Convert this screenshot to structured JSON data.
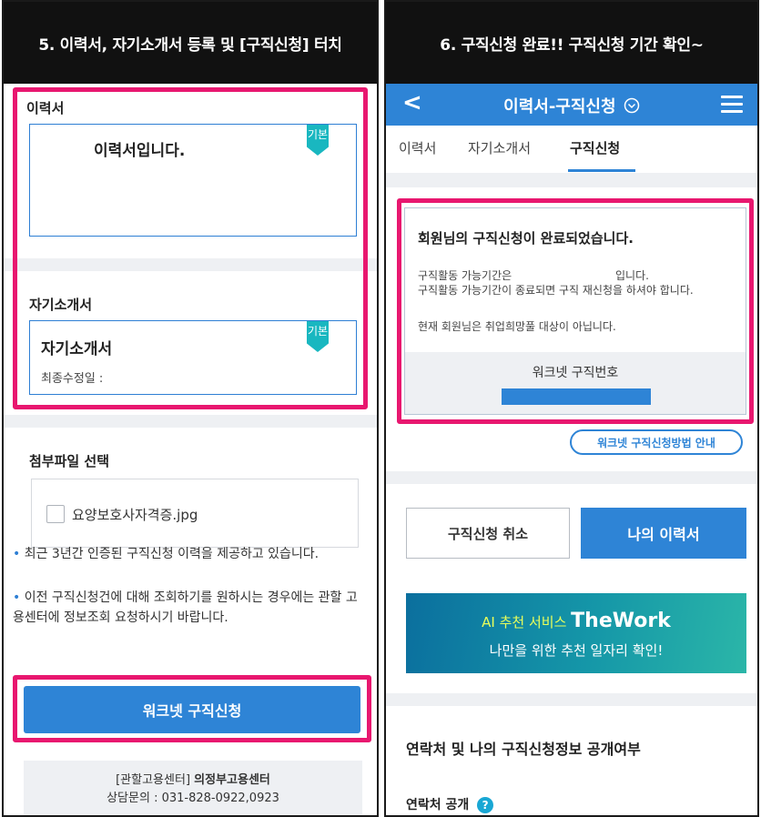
{
  "left": {
    "header": "5. 이력서, 자기소개서 등록 및 [구직신청] 터치",
    "resume_label": "이력서",
    "resume_card_text": "이력서입니다.",
    "badge_label": "기본",
    "intro_label": "자기소개서",
    "intro_card_title": "자기소개서",
    "intro_card_modified": "최종수정일 :",
    "attach_label": "첨부파일 선택",
    "attach_file": "요양보호사자격증.jpg",
    "notes": [
      "최근 3년간 인증된 구직신청 이력을 제공하고 있습니다.",
      "이전 구직신청건에 대해 조회하기를 원하시는 경우에는 관할 고용센터에 정보조회 요청하시기 바랍니다."
    ],
    "apply_button": "워크넷 구직신청",
    "center_prefix": "[관할고용센터]",
    "center_name": "의정부고용센터",
    "consult": "상담문의 : 031-828-0922,0923"
  },
  "right": {
    "header": "6. 구직신청 완료!! 구직신청 기간 확인~",
    "appbar_back": "<",
    "appbar_title": "이력서-구직신청",
    "tabs": [
      "이력서",
      "자기소개서",
      "구직신청"
    ],
    "done_title": "회원님의 구직신청이 완료되었습니다.",
    "done_line1a": "구직활동 가능기간은",
    "done_line1b": "입니다.",
    "done_line2": "구직활동 가능기간이 종료되면 구직 재신청을 하셔야 합니다.",
    "done_line3": "현재 회원님은 취업희망풀 대상이 아닙니다.",
    "worknet_label": "워크넷 구직번호",
    "guide_button": "워크넷 구직신청방법 안내",
    "cancel_button": "구직신청 취소",
    "my_resume_button": "나의 이력서",
    "banner_prefix": "AI 추천 서비스",
    "banner_brand": "TheWork",
    "banner_line2": "나만을 위한 추천 일자리 확인!",
    "contact_section_title": "연락처 및 나의 구직신청정보 공개여부",
    "contact_label": "연락처 공개",
    "help_icon": "?"
  },
  "colors": {
    "highlight": "#e8176f",
    "primary": "#2e84d6",
    "badge": "#19b7c0"
  }
}
